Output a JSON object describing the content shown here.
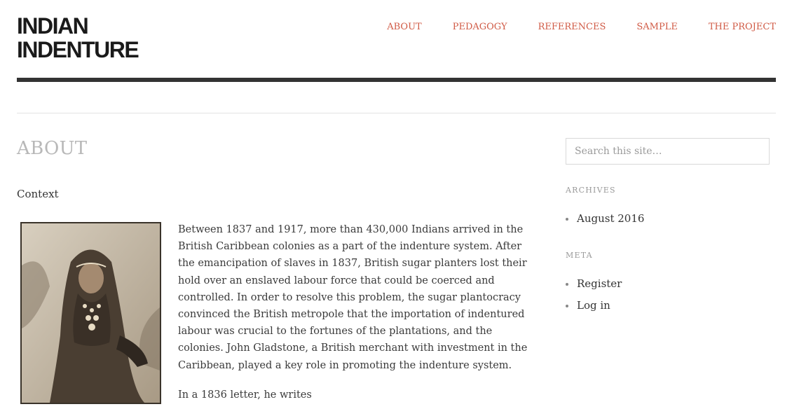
{
  "site": {
    "title_line1": "Indian",
    "title_line2": "Indenture"
  },
  "nav": [
    {
      "label": "About"
    },
    {
      "label": "Pedagogy"
    },
    {
      "label": "References"
    },
    {
      "label": "Sample"
    },
    {
      "label": "The Project"
    }
  ],
  "page": {
    "title": "About",
    "section": "Context",
    "paragraphs": [
      "Between 1837 and 1917, more than 430,000 Indians arrived in the British Caribbean colonies as a part of the indenture system. After the emancipation of slaves in 1837, British sugar planters lost their hold over an enslaved labour force that could be coerced and controlled. In order to resolve this problem, the sugar plantocracy convinced the British metropole that the importation of indentured labour was crucial to the fortunes of the plantations, and the colonies. John Gladstone, a British merchant with investment in the Caribbean, played a key role in promoting the indenture system.",
      "In a 1836 letter, he writes"
    ]
  },
  "sidebar": {
    "search_placeholder": "Search this site…",
    "archives_title": "Archives",
    "archives": [
      "August 2016"
    ],
    "meta_title": "Meta",
    "meta": [
      "Register",
      "Log in"
    ]
  },
  "colors": {
    "accent": "#d05a45",
    "rule": "#333333",
    "muted": "#b8b8b8"
  },
  "icons": {
    "photo": "archival-portrait-photo"
  }
}
